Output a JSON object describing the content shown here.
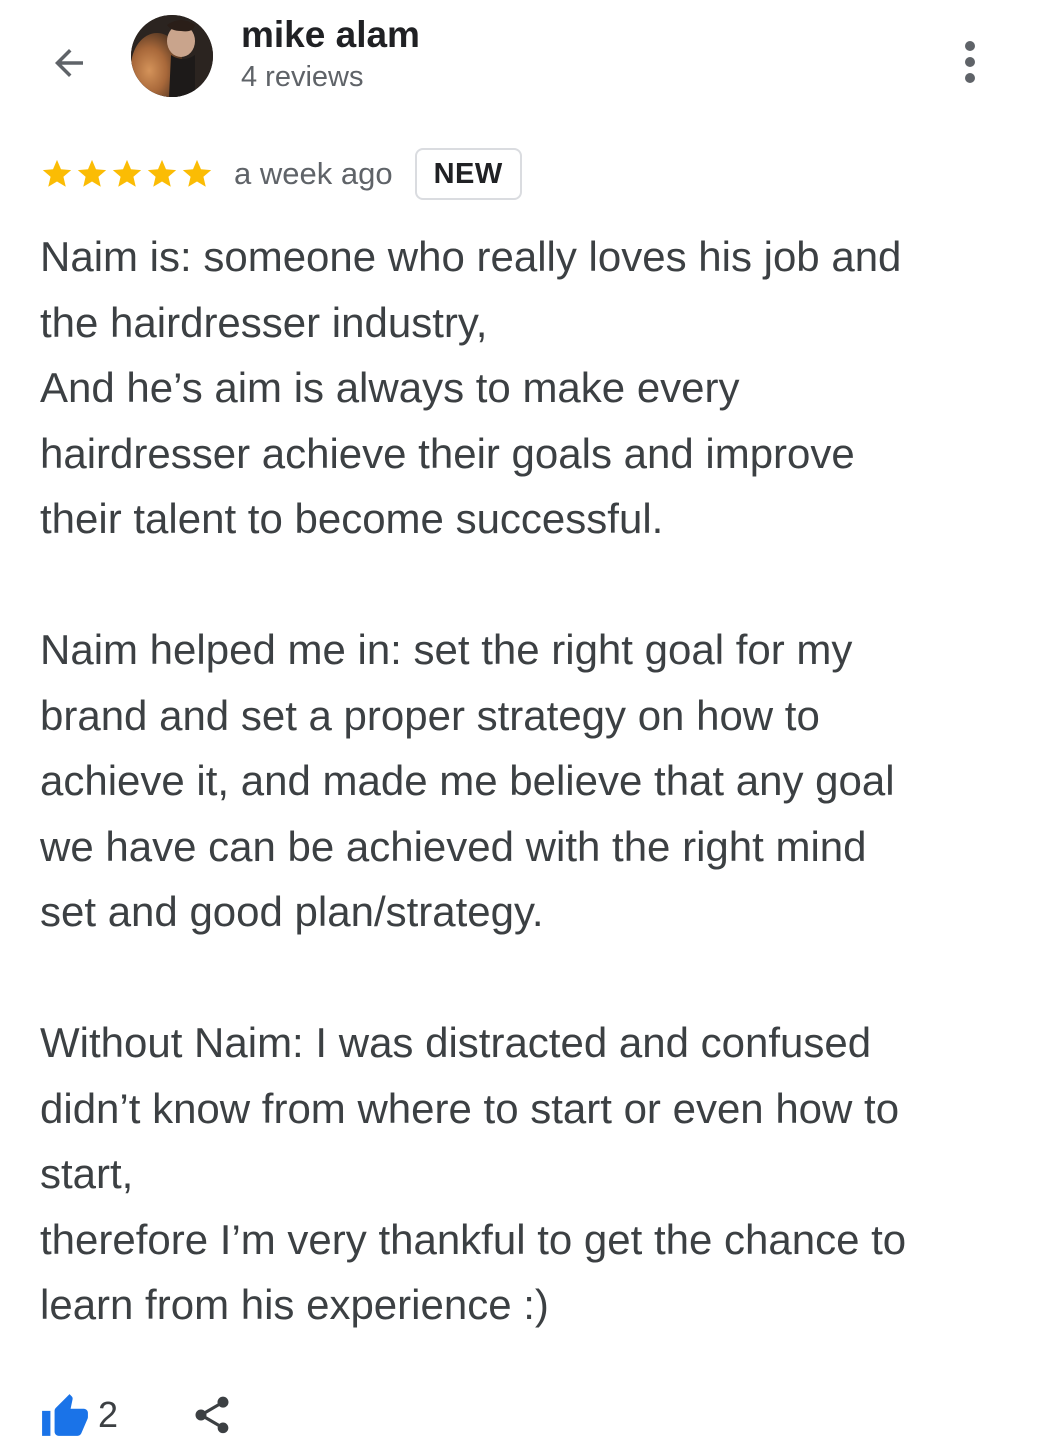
{
  "header": {
    "back_icon": "arrow-back-icon",
    "reviewer_name": "mike alam",
    "reviewer_reviews": "4 reviews",
    "more_icon": "more-vert-icon"
  },
  "review": {
    "rating": 5,
    "rating_max": 5,
    "star_color": "#fbbc04",
    "timestamp": "a week ago",
    "badge": "NEW",
    "paragraphs": [
      [
        "Naim is: someone who really loves his job and",
        "the hairdresser industry,",
        "And he’s aim is always to make every",
        "hairdresser achieve their goals and improve",
        "their talent to become successful."
      ],
      [
        "Naim helped me in: set the right goal for my",
        "brand and set a proper strategy on how to",
        "achieve it, and made me believe that any goal",
        "we have can be achieved with the right mind",
        "set and good plan/strategy."
      ],
      [
        "Without Naim: I was distracted and confused",
        "didn’t know from where to start or even how to",
        "start,",
        "therefore I’m very thankful to get the chance to",
        "learn from his experience :)"
      ]
    ]
  },
  "actions": {
    "like_icon": "thumb-up-icon",
    "like_color": "#1a73e8",
    "like_count": "2",
    "share_icon": "share-icon"
  }
}
